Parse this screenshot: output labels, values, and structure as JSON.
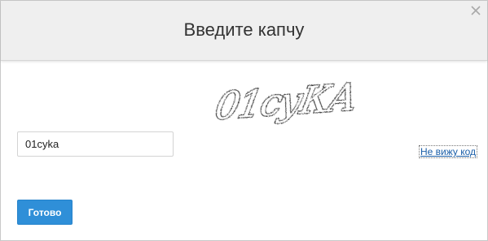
{
  "dialog": {
    "title": "Введите капчу",
    "close_icon": "close-icon"
  },
  "captcha": {
    "text": "01суКА",
    "icon": "captcha-image"
  },
  "form": {
    "answer_value": "01cyka",
    "refresh_label": "Не вижу код",
    "submit_label": "Готово"
  },
  "colors": {
    "header_bg": "#efefef",
    "button_bg": "#2f8fd8",
    "link": "#1a5ea8"
  }
}
